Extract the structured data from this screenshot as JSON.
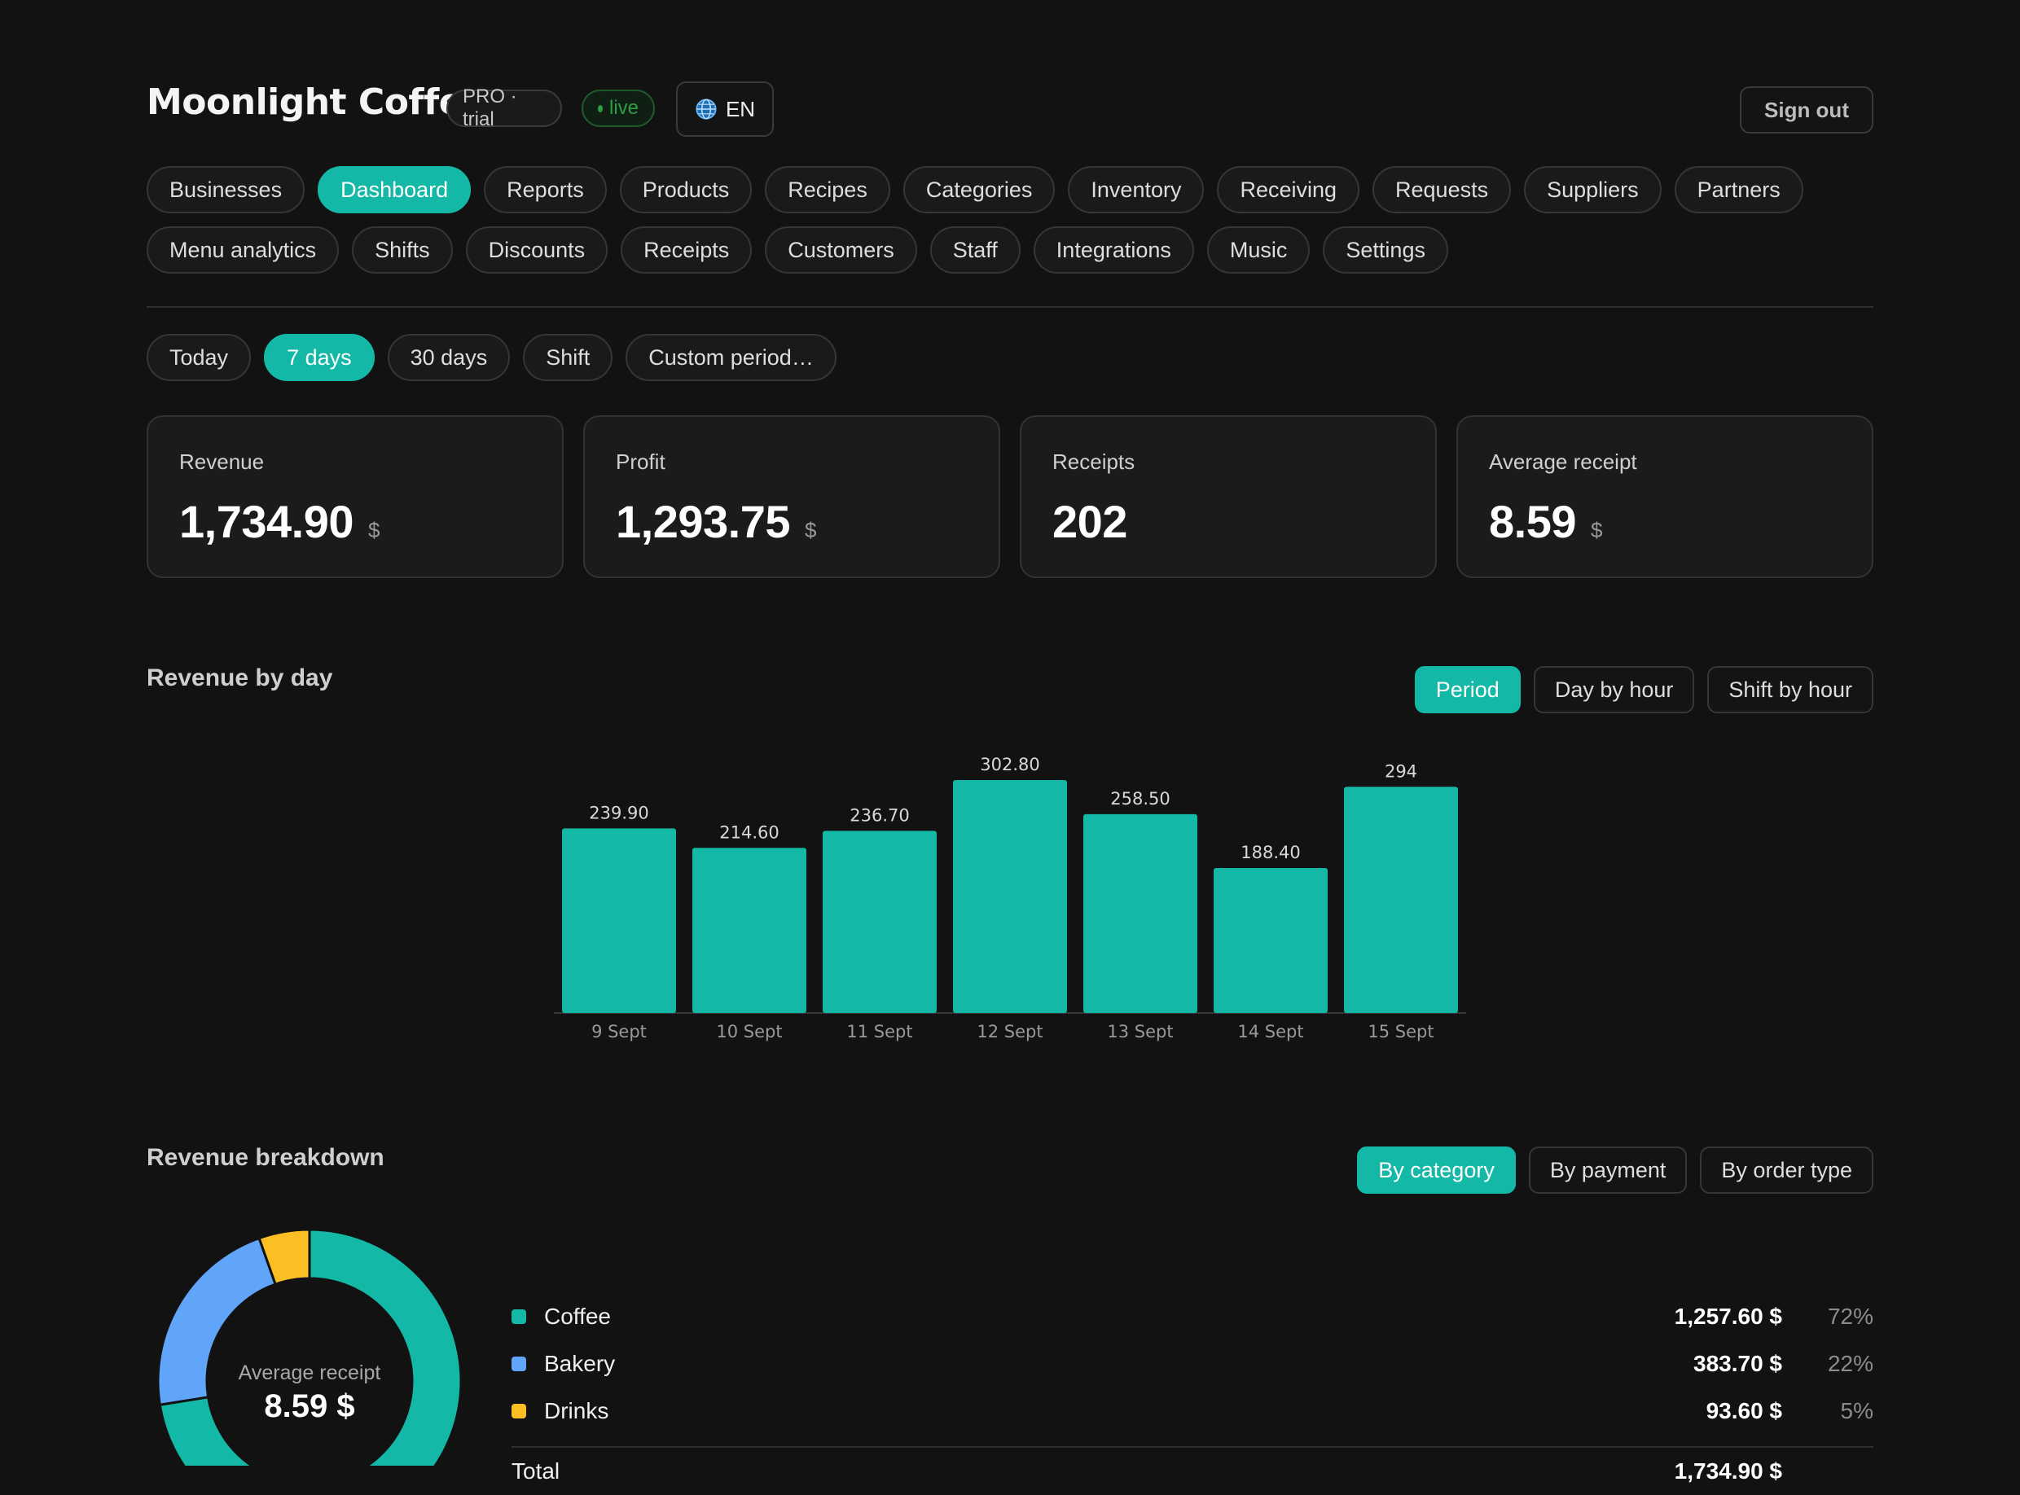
{
  "header": {
    "title": "Moonlight Coffee",
    "plan_badge": "PRO · trial",
    "live_badge": "live",
    "language": "EN",
    "sign_out": "Sign out"
  },
  "nav": {
    "row1": [
      "Businesses",
      "Dashboard",
      "Reports",
      "Products",
      "Recipes",
      "Categories",
      "Inventory",
      "Receiving",
      "Requests",
      "Suppliers",
      "Partners"
    ],
    "row2": [
      "Menu analytics",
      "Shifts",
      "Discounts",
      "Receipts",
      "Customers",
      "Staff",
      "Integrations",
      "Music",
      "Settings"
    ],
    "active": "Dashboard"
  },
  "periods": {
    "items": [
      "Today",
      "7 days",
      "30 days",
      "Shift",
      "Custom period…"
    ],
    "active": "7 days"
  },
  "stats": [
    {
      "label": "Revenue",
      "value": "1,734.90",
      "currency": "$"
    },
    {
      "label": "Profit",
      "value": "1,293.75",
      "currency": "$"
    },
    {
      "label": "Receipts",
      "value": "202",
      "currency": ""
    },
    {
      "label": "Average receipt",
      "value": "8.59",
      "currency": "$"
    }
  ],
  "revenue_by_day": {
    "title": "Revenue by day",
    "modes": [
      "Period",
      "Day by hour",
      "Shift by hour"
    ],
    "active_mode": "Period"
  },
  "revenue_breakdown": {
    "title": "Revenue breakdown",
    "modes": [
      "By category",
      "By payment",
      "By order type"
    ],
    "active_mode": "By category",
    "donut_label": "Average receipt",
    "donut_value": "8.59 $",
    "items": [
      {
        "name": "Coffee",
        "amount": "1,257.60 $",
        "pct": "72%",
        "color": "#14b8a6"
      },
      {
        "name": "Bakery",
        "amount": "383.70 $",
        "pct": "22%",
        "color": "#60a5fa"
      },
      {
        "name": "Drinks",
        "amount": "93.60 $",
        "pct": "5%",
        "color": "#fbbf24"
      }
    ],
    "total_label": "Total",
    "total_amount": "1,734.90 $"
  },
  "colors": {
    "accent": "#14b8a6",
    "bakery": "#60a5fa",
    "drinks": "#fbbf24",
    "live": "#2e9e45",
    "background": "#121212"
  },
  "chart_data": [
    {
      "type": "bar",
      "title": "Revenue by day",
      "categories": [
        "9 Sept",
        "10 Sept",
        "11 Sept",
        "12 Sept",
        "13 Sept",
        "14 Sept",
        "15 Sept"
      ],
      "values": [
        239.9,
        214.6,
        236.7,
        302.8,
        258.5,
        188.4,
        294
      ],
      "labels": [
        "239.90",
        "214.60",
        "236.70",
        "302.80",
        "258.50",
        "188.40",
        "294"
      ],
      "ylim": [
        0,
        302.8
      ],
      "grid": false,
      "color": "#14b8a6"
    },
    {
      "type": "pie",
      "categories": [
        "Coffee",
        "Bakery",
        "Drinks"
      ],
      "values": [
        1257.6,
        383.7,
        93.6
      ],
      "colors": [
        "#14b8a6",
        "#60a5fa",
        "#fbbf24"
      ]
    }
  ]
}
